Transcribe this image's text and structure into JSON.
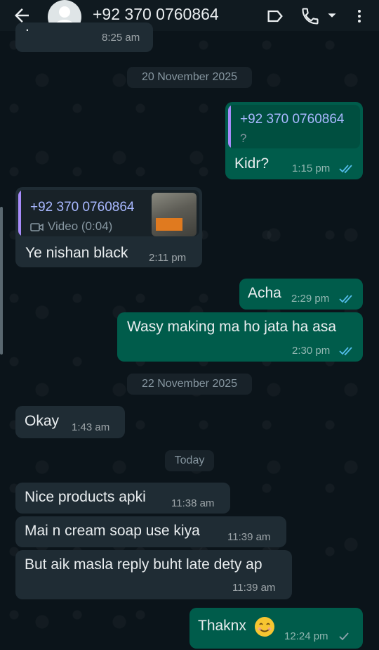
{
  "header": {
    "contact_name": "+92 370 0760864"
  },
  "dates": {
    "first": "20 November 2025",
    "second": "22 November 2025",
    "third": "Today"
  },
  "messages": [
    {
      "text": ".",
      "time": "8:25 am"
    },
    {
      "quote_name": "+92 370 0760864",
      "quote_text": "?",
      "text": "Kidr?",
      "time": "1:15 pm",
      "status": "read"
    },
    {
      "quote_name": "+92 370 0760864",
      "quote_text": "Video (0:04)",
      "text": "Ye nishan black",
      "time": "2:11 pm"
    },
    {
      "text": "Acha",
      "time": "2:29 pm",
      "status": "read"
    },
    {
      "text": "Wasy making ma ho jata ha asa",
      "time": "2:30 pm",
      "status": "read"
    },
    {
      "text": "Okay",
      "time": "1:43 am"
    },
    {
      "text": "Nice products apki",
      "time": "11:38 am"
    },
    {
      "text": "Mai n cream soap use kiya",
      "time": "11:39 am"
    },
    {
      "text": "But aik masla reply buht late dety ap",
      "time": "11:39 am"
    },
    {
      "text": "Thaknx",
      "time": "12:24 pm",
      "status": "sent"
    }
  ],
  "colors": {
    "outgoing_bubble": "#005c4b",
    "incoming_bubble": "#1f2c34",
    "read_tick": "#53bdeb"
  }
}
